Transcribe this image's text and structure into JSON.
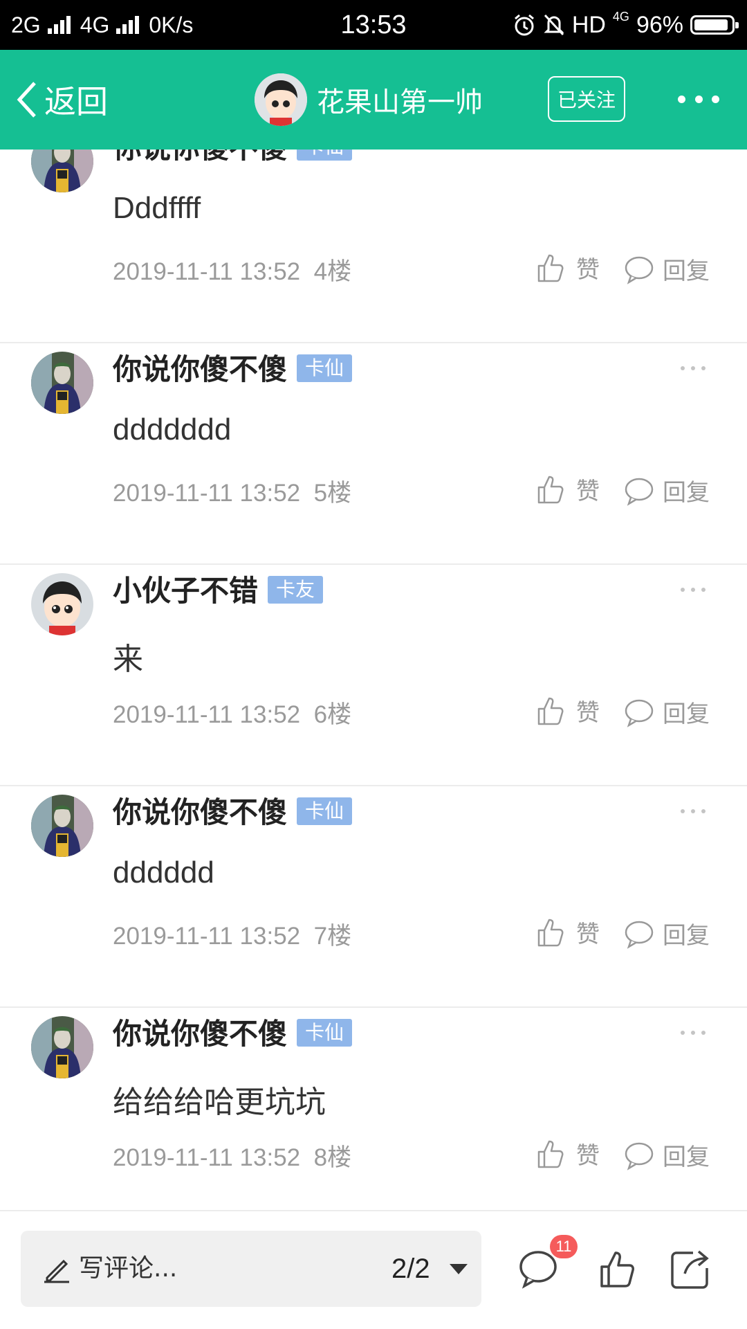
{
  "status_bar": {
    "network_left": "2G",
    "network_mid": "4G",
    "speed": "0K/s",
    "time": "13:53",
    "hd": "HD",
    "net_4g": "4G",
    "battery": "96%"
  },
  "header": {
    "back_label": "返回",
    "title": "花果山第一帅",
    "follow_label": "已关注"
  },
  "comments": [
    {
      "name": "你说你傻不傻",
      "badge": "卡仙",
      "body": "Dddffff",
      "time": "2019-11-11 13:52",
      "floor": "4楼",
      "like": "赞",
      "reply": "回复",
      "avatar": "joker"
    },
    {
      "name": "你说你傻不傻",
      "badge": "卡仙",
      "body": "ddddddd",
      "time": "2019-11-11 13:52",
      "floor": "5楼",
      "like": "赞",
      "reply": "回复",
      "avatar": "joker"
    },
    {
      "name": "小伙子不错",
      "badge": "卡友",
      "body": "来",
      "time": "2019-11-11 13:52",
      "floor": "6楼",
      "like": "赞",
      "reply": "回复",
      "avatar": "cartoon-boy"
    },
    {
      "name": "你说你傻不傻",
      "badge": "卡仙",
      "body": "dddddd",
      "time": "2019-11-11 13:52",
      "floor": "7楼",
      "like": "赞",
      "reply": "回复",
      "avatar": "joker"
    },
    {
      "name": "你说你傻不傻",
      "badge": "卡仙",
      "body": "给给给哈更坑坑",
      "time": "2019-11-11 13:52",
      "floor": "8楼",
      "like": "赞",
      "reply": "回复",
      "avatar": "joker"
    }
  ],
  "bottom_bar": {
    "comment_placeholder": "写评论...",
    "page": "2/2",
    "comment_count": "11"
  },
  "colors": {
    "accent": "#15bf93",
    "badge": "#8fb6ea",
    "notification": "#f55b5b"
  },
  "icons": [
    "signal-icon",
    "alarm-icon",
    "mute-icon",
    "battery-icon",
    "back-arrow-icon",
    "more-icon",
    "like-icon",
    "reply-icon",
    "pen-icon",
    "dropdown-icon",
    "comment-icon",
    "thumbs-up-icon",
    "share-icon"
  ]
}
